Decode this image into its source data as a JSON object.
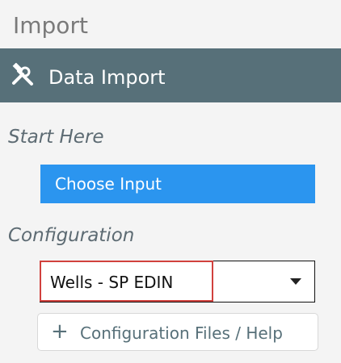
{
  "panel": {
    "title": "Import"
  },
  "header": {
    "icon": "tools-icon",
    "label": "Data Import"
  },
  "sections": {
    "start_label": "Start Here",
    "config_label": "Configuration"
  },
  "choose_input": {
    "label": "Choose Input",
    "color": "#2b95ef"
  },
  "config_select": {
    "value": "Wells - SP EDIN",
    "icon": "chevron-down-icon",
    "highlight_color": "#d1413d"
  },
  "config_files": {
    "icon": "plus-icon",
    "label": "Configuration Files / Help"
  },
  "colors": {
    "header_bg": "#577079",
    "panel_bg": "#f4f4f4"
  }
}
